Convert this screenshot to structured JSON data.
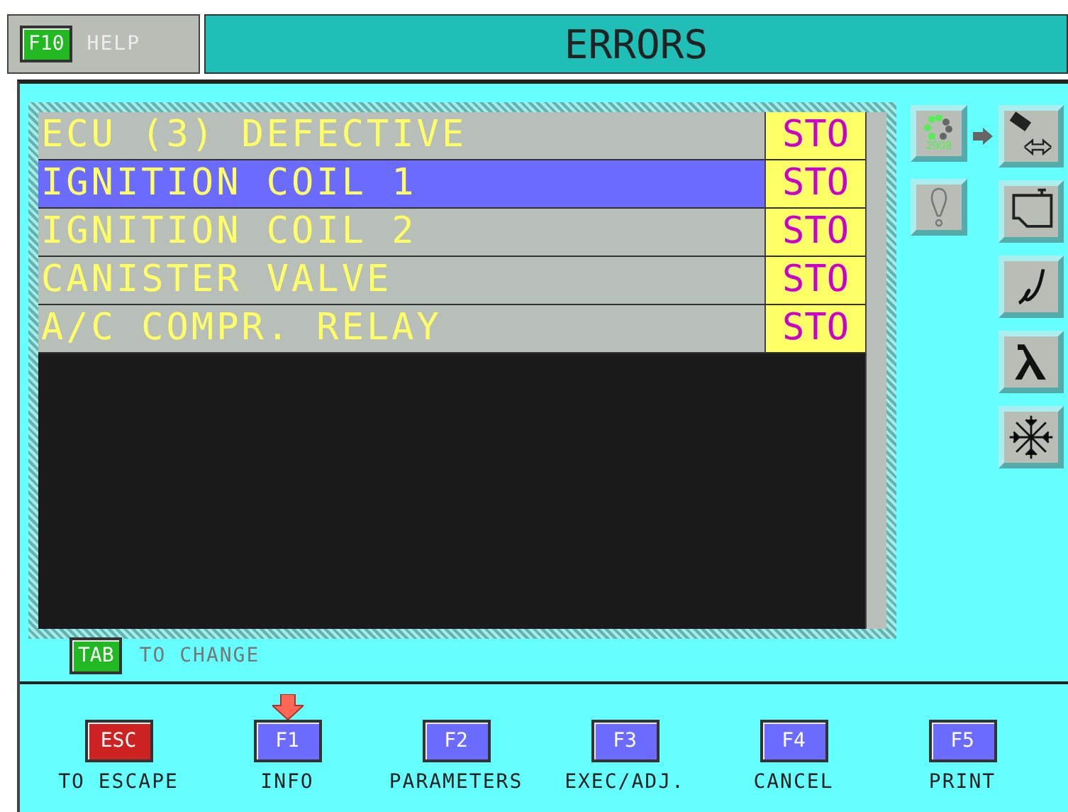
{
  "header": {
    "help_key": "F10",
    "help_label": "HELP",
    "title": "ERRORS"
  },
  "errors": [
    {
      "description": "ECU (3) DEFECTIVE",
      "status": "STO",
      "selected": false
    },
    {
      "description": "IGNITION COIL 1",
      "status": "STO",
      "selected": true
    },
    {
      "description": "IGNITION COIL 2",
      "status": "STO",
      "selected": false
    },
    {
      "description": "CANISTER VALVE",
      "status": "STO",
      "selected": false
    },
    {
      "description": "A/C COMPR. RELAY",
      "status": "STO",
      "selected": false
    }
  ],
  "side_icons": {
    "status_code": "2908"
  },
  "tab_hint": {
    "key": "TAB",
    "label": "TO CHANGE"
  },
  "function_keys": [
    {
      "key": "ESC",
      "label": "TO ESCAPE",
      "color": "#cc2222",
      "pointed": false
    },
    {
      "key": "F1",
      "label": "INFO",
      "color": "#6b6bff",
      "pointed": true
    },
    {
      "key": "F2",
      "label": "PARAMETERS",
      "color": "#6b6bff",
      "pointed": false
    },
    {
      "key": "F3",
      "label": "EXEC/ADJ.",
      "color": "#6b6bff",
      "pointed": false
    },
    {
      "key": "F4",
      "label": "CANCEL",
      "color": "#6b6bff",
      "pointed": false
    },
    {
      "key": "F5",
      "label": "PRINT",
      "color": "#6b6bff",
      "pointed": false
    }
  ]
}
